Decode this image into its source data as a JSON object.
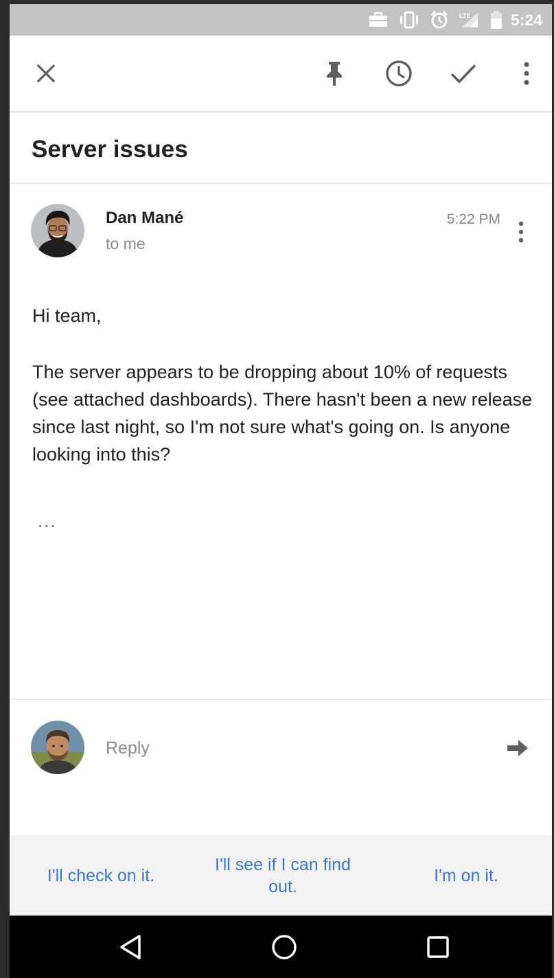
{
  "status_bar": {
    "time": "5:24",
    "icons": [
      "briefcase-icon",
      "vibrate-icon",
      "alarm-icon",
      "lte-signal-icon",
      "battery-icon"
    ]
  },
  "toolbar": {
    "icons": [
      "close-icon",
      "pin-icon",
      "snooze-icon",
      "done-icon",
      "more-vert-icon"
    ]
  },
  "email": {
    "subject": "Server issues",
    "sender_name": "Dan Mané",
    "recipient": "to me",
    "time": "5:22 PM",
    "greeting": "Hi team,",
    "body": "The server appears to be dropping about 10% of requests (see attached dashboards).  There hasn't been a new release since last night, so I'm not sure what's going on.  Is anyone looking into this?",
    "ellipsis": "..."
  },
  "reply": {
    "placeholder": "Reply"
  },
  "smart_replies": [
    "I'll check on it.",
    "I'll see if I can find out.",
    "I'm on it."
  ],
  "colors": {
    "accent": "#3b78d4",
    "status_bar": "#c3c3c3",
    "smart_reply_bg": "#f2f2f2",
    "nav_bar": "#000000"
  }
}
